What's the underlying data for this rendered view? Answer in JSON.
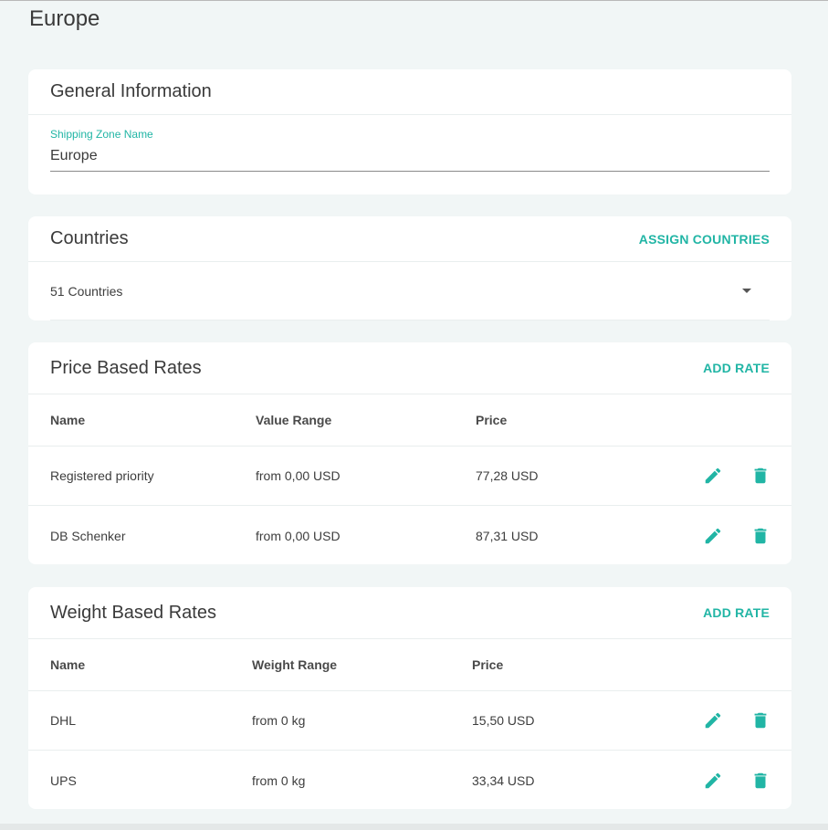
{
  "page": {
    "title": "Europe"
  },
  "general": {
    "title": "General Information",
    "field_label": "Shipping Zone Name",
    "field_value": "Europe"
  },
  "countries": {
    "title": "Countries",
    "action": "ASSIGN COUNTRIES",
    "summary": "51 Countries"
  },
  "price_rates": {
    "title": "Price Based Rates",
    "action": "ADD RATE",
    "columns": [
      "Name",
      "Value Range",
      "Price"
    ],
    "rows": [
      [
        "Registered priority",
        "from 0,00 USD",
        "77,28 USD"
      ],
      [
        "DB Schenker",
        "from 0,00 USD",
        "87,31 USD"
      ]
    ]
  },
  "weight_rates": {
    "title": "Weight Based Rates",
    "action": "ADD RATE",
    "columns": [
      "Name",
      "Weight Range",
      "Price"
    ],
    "rows": [
      [
        "DHL",
        "from 0 kg",
        "15,50 USD"
      ],
      [
        "UPS",
        "from 0 kg",
        "33,34 USD"
      ]
    ]
  },
  "icons": {
    "edit": "pencil-icon",
    "delete": "trash-icon"
  },
  "colors": {
    "accent": "#21b5a5",
    "background": "#f1f6f6"
  }
}
